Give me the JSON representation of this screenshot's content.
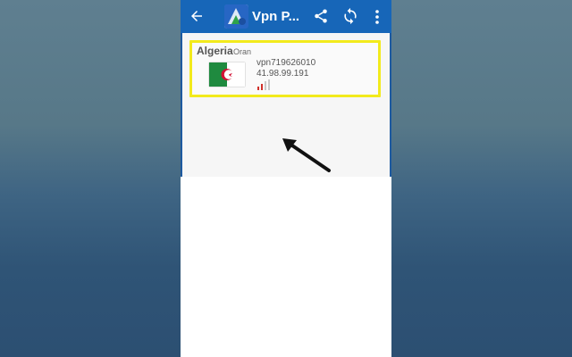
{
  "appbar": {
    "title": "Vpn P...",
    "icons": [
      "back-arrow-icon",
      "app-logo-icon",
      "share-icon",
      "refresh-icon",
      "more-vert-icon"
    ],
    "color": "#1766b8"
  },
  "server_list": [
    {
      "country": "Algeria",
      "city": "Oran",
      "server_name": "vpn719626010",
      "ip": "41.98.99.191",
      "flag": "algeria-flag",
      "signal_bars_active": 2,
      "signal_bars_total": 4
    }
  ],
  "highlight_color": "#f2ea1c"
}
